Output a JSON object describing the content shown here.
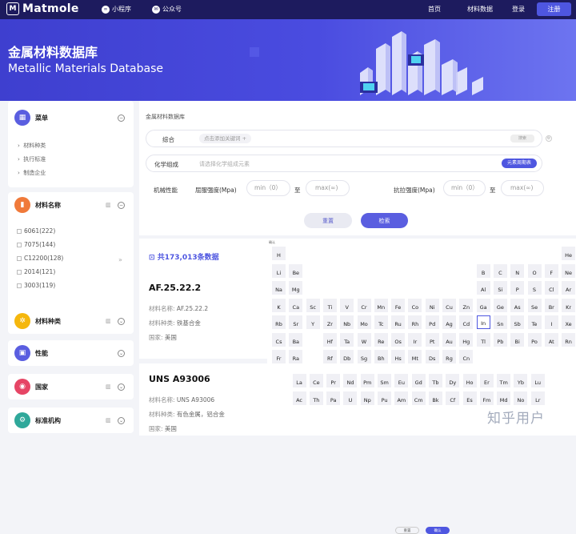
{
  "nav": {
    "logo_mark": "M",
    "brand": "Matmole",
    "mini_program": "小程序",
    "wechat": "公众号",
    "home": "首页",
    "materials_data": "材料数据",
    "login": "登录",
    "register": "注册"
  },
  "hero": {
    "title_cn": "金属材料数据库",
    "title_en": "Metallic Materials Database"
  },
  "sidebar": {
    "menu": {
      "title": "菜单",
      "items": [
        "材料种类",
        "执行标准",
        "制造企业"
      ]
    },
    "material_name": {
      "title": "材料名称",
      "items": [
        "6061(222)",
        "7075(144)",
        "C12200(128)",
        "2014(121)",
        "3003(119)"
      ]
    },
    "material_type": {
      "title": "材料种类"
    },
    "performance": {
      "title": "性能"
    },
    "country": {
      "title": "国家"
    },
    "standard_org": {
      "title": "标准机构"
    }
  },
  "filter": {
    "breadcrumb": "金属材料数据库",
    "general_label": "综合",
    "keyword_placeholder": "点击添加关键词",
    "search_small": "搜索",
    "chem_label": "化学组成",
    "chem_placeholder": "请选择化学组成元素",
    "periodic_button": "元素周期表",
    "mech_label": "机械性能",
    "yield_label": "屈服强度(Mpa)",
    "yield_min": "min（0）",
    "to1": "至",
    "yield_max": "max(∞)",
    "tensile_label": "抗拉强度(Mpa)",
    "tensile_min": "min（0）",
    "to2": "至",
    "tensile_max": "max(∞)",
    "reset": "重置",
    "search": "检索"
  },
  "results": {
    "count": "共173,013条数据",
    "items": [
      {
        "title": "AF.25.22.2",
        "name_label": "材料名称:",
        "name": "AF.25.22.2",
        "type_label": "材料种类:",
        "type": "铁基合金",
        "country_label": "国家:",
        "country": "美国"
      },
      {
        "title": "UNS A93006",
        "name_label": "材料名称:",
        "name": "UNS A93006",
        "type_label": "材料种类:",
        "type": "有色金属，铝合金",
        "country_label": "国家:",
        "country": "美国"
      }
    ]
  },
  "periodic": {
    "header": "确认",
    "selected": "In",
    "cancel": "重置",
    "confirm": "确认",
    "rows": [
      [
        "H",
        "",
        "",
        "",
        "",
        "",
        "",
        "",
        "",
        "",
        "",
        "",
        "",
        "",
        "",
        "",
        "",
        "He"
      ],
      [
        "Li",
        "Be",
        "",
        "",
        "",
        "",
        "",
        "",
        "",
        "",
        "",
        "",
        "B",
        "C",
        "N",
        "O",
        "F",
        "Ne"
      ],
      [
        "Na",
        "Mg",
        "",
        "",
        "",
        "",
        "",
        "",
        "",
        "",
        "",
        "",
        "Al",
        "Si",
        "P",
        "S",
        "Cl",
        "Ar"
      ],
      [
        "K",
        "Ca",
        "Sc",
        "Ti",
        "V",
        "Cr",
        "Mn",
        "Fe",
        "Co",
        "Ni",
        "Cu",
        "Zn",
        "Ga",
        "Ge",
        "As",
        "Se",
        "Br",
        "Kr"
      ],
      [
        "Rb",
        "Sr",
        "Y",
        "Zr",
        "Nb",
        "Mo",
        "Tc",
        "Ru",
        "Rh",
        "Pd",
        "Ag",
        "Cd",
        "In",
        "Sn",
        "Sb",
        "Te",
        "I",
        "Xe"
      ],
      [
        "Cs",
        "Ba",
        "",
        "Hf",
        "Ta",
        "W",
        "Re",
        "Os",
        "Ir",
        "Pt",
        "Au",
        "Hg",
        "Tl",
        "Pb",
        "Bi",
        "Po",
        "At",
        "Rn"
      ],
      [
        "Fr",
        "Ra",
        "",
        "Rf",
        "Db",
        "Sg",
        "Bh",
        "Hs",
        "Mt",
        "Ds",
        "Rg",
        "Cn",
        "",
        "",
        "",
        "",
        "",
        ""
      ]
    ],
    "lanthanides": [
      "La",
      "Ce",
      "Pr",
      "Nd",
      "Pm",
      "Sm",
      "Eu",
      "Gd",
      "Tb",
      "Dy",
      "Ho",
      "Er",
      "Tm",
      "Yb",
      "Lu"
    ],
    "actinides": [
      "Ac",
      "Th",
      "Pa",
      "U",
      "Np",
      "Pu",
      "Am",
      "Cm",
      "Bk",
      "Cf",
      "Es",
      "Fm",
      "Md",
      "No",
      "Lr"
    ]
  },
  "watermark": "知乎用户"
}
